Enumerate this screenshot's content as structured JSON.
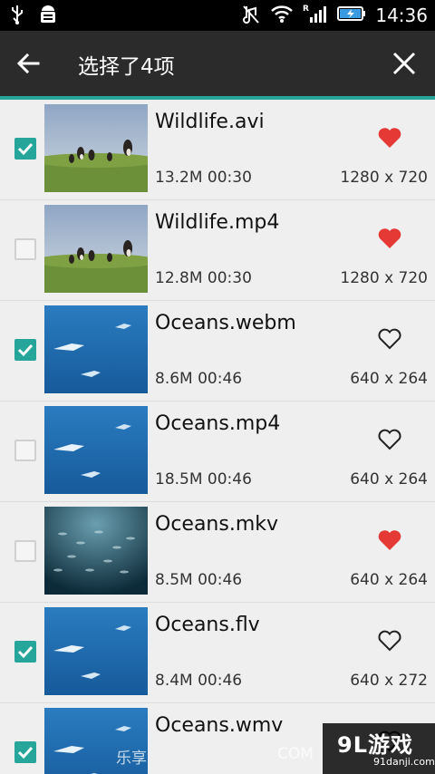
{
  "status_bar": {
    "time": "14:36"
  },
  "toolbar": {
    "title": "选择了4项"
  },
  "items": [
    {
      "name": "Wildlife.avi",
      "size_duration": "13.2M 00:30",
      "resolution": "1280 x 720",
      "checked": true,
      "favorite": true,
      "thumb": "wildlife"
    },
    {
      "name": "Wildlife.mp4",
      "size_duration": "12.8M 00:30",
      "resolution": "1280 x 720",
      "checked": false,
      "favorite": true,
      "thumb": "wildlife"
    },
    {
      "name": "Oceans.webm",
      "size_duration": "8.6M 00:46",
      "resolution": "640 x 264",
      "checked": true,
      "favorite": false,
      "thumb": "ocean"
    },
    {
      "name": "Oceans.mp4",
      "size_duration": "18.5M 00:46",
      "resolution": "640 x 264",
      "checked": false,
      "favorite": false,
      "thumb": "ocean"
    },
    {
      "name": "Oceans.mkv",
      "size_duration": "8.5M 00:46",
      "resolution": "640 x 264",
      "checked": false,
      "favorite": true,
      "thumb": "fish"
    },
    {
      "name": "Oceans.flv",
      "size_duration": "8.4M 00:46",
      "resolution": "640 x 272",
      "checked": true,
      "favorite": false,
      "thumb": "ocean"
    },
    {
      "name": "Oceans.wmv",
      "size_duration": "",
      "resolution": "",
      "checked": true,
      "favorite": false,
      "thumb": "ocean"
    }
  ],
  "watermark": {
    "left": "乐享",
    "com": "COM",
    "logo": "9L游戏",
    "url": "91danji.com"
  },
  "colors": {
    "accent": "#26a69a",
    "favorite": "#e53935",
    "toolbar": "#2b2b2b"
  }
}
